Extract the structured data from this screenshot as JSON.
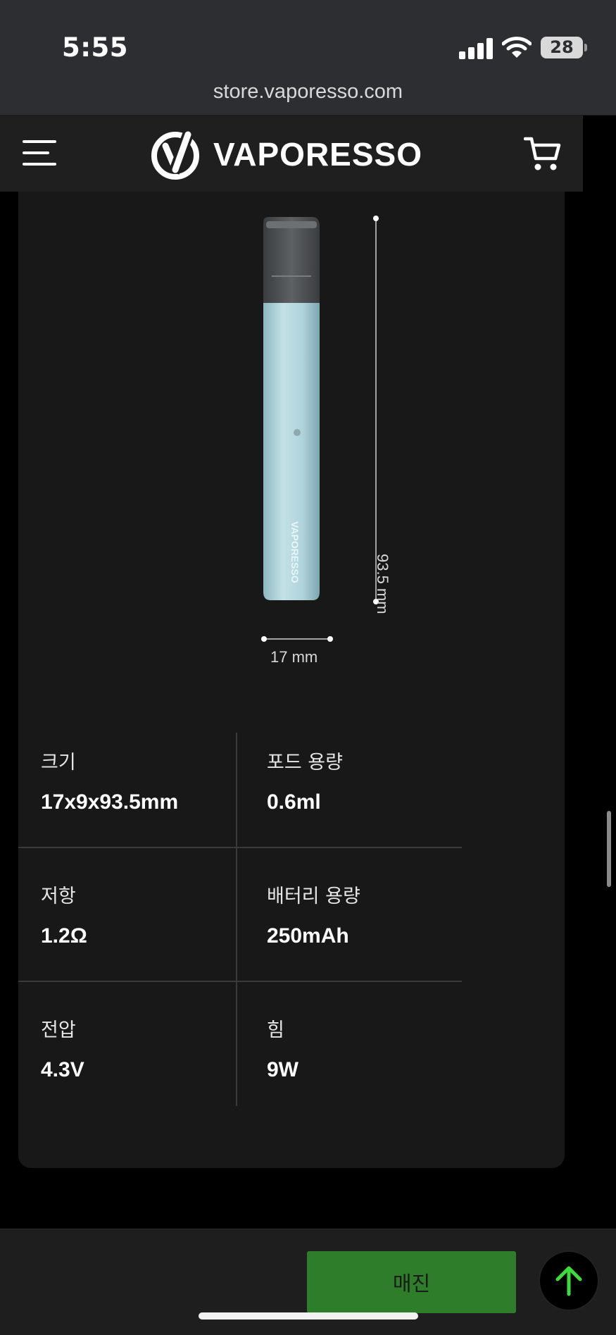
{
  "status_bar": {
    "time": "5:55",
    "battery": "28"
  },
  "browser": {
    "url": "store.vaporesso.com"
  },
  "header": {
    "brand": "VAPORESSO"
  },
  "product_image": {
    "height_label": "93.5 mm",
    "width_label": "17 mm",
    "device_brand_text": "VAPORESSO"
  },
  "specs": [
    {
      "label": "크기",
      "value": "17x9x93.5mm"
    },
    {
      "label": "포드 용량",
      "value": "0.6ml"
    },
    {
      "label": "저항",
      "value": "1.2Ω"
    },
    {
      "label": "배터리 용량",
      "value": "250mAh"
    },
    {
      "label": "전압",
      "value": "4.3V"
    },
    {
      "label": "힘",
      "value": "9W"
    }
  ],
  "footer": {
    "sold_out_label": "매진"
  },
  "colors": {
    "accent_green": "#2e7d2a",
    "scroll_top_arrow": "#3ddc3a",
    "device_body": "#b6d6dd"
  }
}
